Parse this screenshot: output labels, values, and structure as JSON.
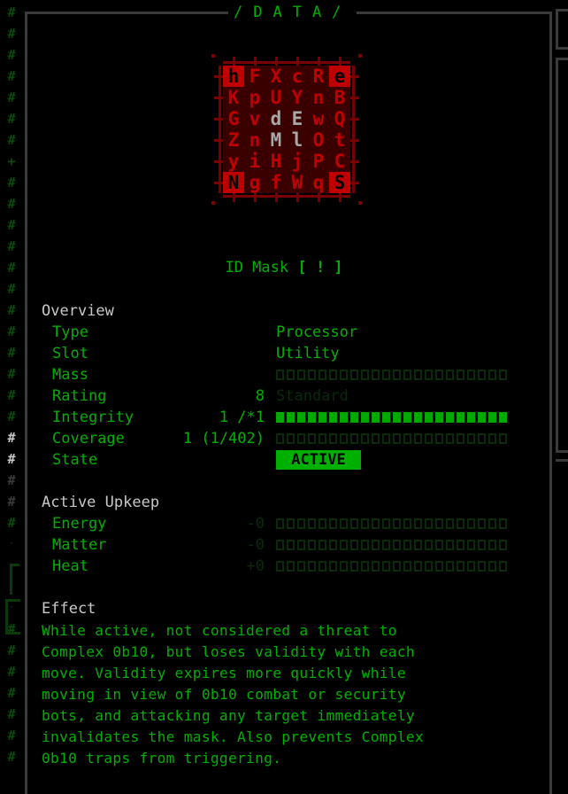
{
  "window": {
    "title": "/DATA/"
  },
  "gutter": {
    "glyphs": [
      "#",
      "#",
      "#",
      "#",
      "#",
      "#",
      "#",
      "+",
      "#",
      "#",
      "#",
      "#",
      "#",
      "#",
      "#",
      "#",
      "#",
      "#",
      "#",
      "#",
      "#",
      "#",
      "#",
      "#",
      "#",
      "·",
      "",
      "",
      "·",
      "#",
      "#",
      "#",
      "#",
      "#"
    ],
    "rows": [
      {
        "char": "#",
        "tone": "dim"
      },
      {
        "char": "#",
        "tone": "dim"
      },
      {
        "char": "#",
        "tone": "dim"
      },
      {
        "char": "#",
        "tone": "dim"
      },
      {
        "char": "#",
        "tone": "dim"
      },
      {
        "char": "#",
        "tone": "dim"
      },
      {
        "char": "#",
        "tone": "dim"
      },
      {
        "char": "+",
        "tone": "dim"
      },
      {
        "char": "#",
        "tone": "dim"
      },
      {
        "char": "#",
        "tone": "dim"
      },
      {
        "char": "#",
        "tone": "dim"
      },
      {
        "char": "#",
        "tone": "dim"
      },
      {
        "char": "#",
        "tone": "dim"
      },
      {
        "char": "#",
        "tone": "dim"
      },
      {
        "char": "#",
        "tone": "dim"
      },
      {
        "char": "#",
        "tone": "dim"
      },
      {
        "char": "#",
        "tone": "dim"
      },
      {
        "char": "#",
        "tone": "dim"
      },
      {
        "char": "#",
        "tone": "dim"
      },
      {
        "char": "#",
        "tone": "dim"
      },
      {
        "char": "#",
        "tone": "white"
      },
      {
        "char": "#",
        "tone": "white"
      },
      {
        "char": "#",
        "tone": "gray"
      },
      {
        "char": "#",
        "tone": "gray"
      },
      {
        "char": "#",
        "tone": "dim"
      },
      {
        "char": "·",
        "tone": "dot"
      },
      {
        "char": "",
        "tone": "dim"
      },
      {
        "char": "",
        "tone": "dim"
      },
      {
        "char": "·",
        "tone": "dot"
      },
      {
        "char": "#",
        "tone": "dim"
      },
      {
        "char": "#",
        "tone": "dim"
      },
      {
        "char": "#",
        "tone": "dim"
      },
      {
        "char": "#",
        "tone": "dim"
      },
      {
        "char": "#",
        "tone": "dim"
      },
      {
        "char": "#",
        "tone": "dim"
      },
      {
        "char": "#",
        "tone": "dim"
      }
    ]
  },
  "art": {
    "rows": [
      [
        "h",
        "F",
        "X",
        "c",
        "R",
        "e"
      ],
      [
        "K",
        "p",
        "U",
        "Y",
        "n",
        "B"
      ],
      [
        "G",
        "v",
        "d",
        "E",
        "w",
        "Q"
      ],
      [
        "Z",
        "n",
        "M",
        "l",
        "O",
        "t"
      ],
      [
        "y",
        "i",
        "H",
        "j",
        "P",
        "C"
      ],
      [
        "N",
        "g",
        "f",
        "W",
        "q",
        "S"
      ]
    ],
    "gray_cells": [
      "2,2",
      "2,3",
      "3,2",
      "3,3"
    ],
    "corner_cells": [
      "0,0",
      "0,5",
      "5,0",
      "5,5"
    ],
    "colors": {
      "board": "#3a0000",
      "glyph": "#c00000",
      "frame": "#7a0000",
      "center": "#a8a8a8"
    }
  },
  "item": {
    "name": "ID Mask",
    "marker": "[ ! ]"
  },
  "overview": {
    "heading": "Overview",
    "rows": [
      {
        "label": "Type",
        "num": "",
        "value": "Processor",
        "kind": "text"
      },
      {
        "label": "Slot",
        "num": "",
        "value": "Utility",
        "kind": "text"
      },
      {
        "label": "Mass",
        "num": "",
        "value": "",
        "kind": "bar",
        "fill": 0
      },
      {
        "label": "Rating",
        "num": "8",
        "value": "Standard",
        "kind": "dimtext"
      },
      {
        "label": "Integrity",
        "num": "1 /*1",
        "value": "",
        "kind": "bar",
        "fill": 1.0
      },
      {
        "label": "Coverage",
        "num": "1 (1/402)",
        "value": "",
        "kind": "bar",
        "fill": 0
      },
      {
        "label": "State",
        "num": "",
        "value": "ACTIVE",
        "kind": "badge"
      }
    ]
  },
  "upkeep": {
    "heading": "Active Upkeep",
    "rows": [
      {
        "label": "Energy",
        "num": "-0",
        "fill": 0
      },
      {
        "label": "Matter",
        "num": "-0",
        "fill": 0
      },
      {
        "label": "Heat",
        "num": "+0",
        "fill": 0
      }
    ]
  },
  "effect": {
    "heading": "Effect",
    "text": "While active, not considered a threat to Complex 0b10, but loses validity with each move. Validity expires more quickly while moving in view of 0b10 combat or security bots, and attacking any target immediately invalidates the mask. Also prevents Complex 0b10 traps from triggering.",
    "lines": [
      "While active, not considered a threat to",
      "Complex 0b10, but loses validity with each",
      "move. Validity expires more quickly while",
      "moving in view of 0b10 combat or security",
      "bots, and attacking any target immediately",
      "invalidates the mask. Also prevents Complex",
      "0b10 traps from triggering."
    ]
  },
  "colors": {
    "accent": "#00b000",
    "dim": "#0a2a0a",
    "frame": "#3a3a3a",
    "heading": "#c8c8c8",
    "bar_on": "#00a800"
  }
}
